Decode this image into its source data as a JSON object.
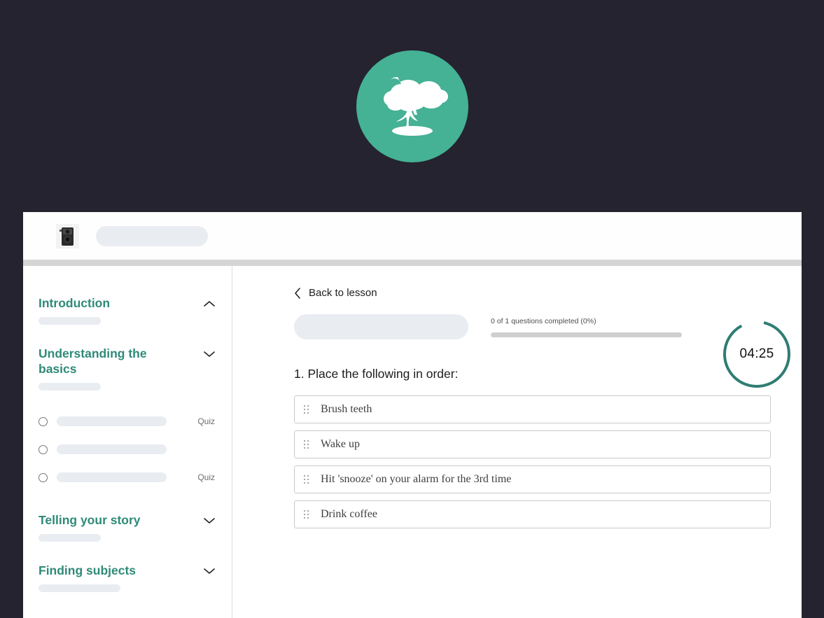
{
  "theme": {
    "page_background": "#25232f",
    "brand_teal": "#45b195",
    "heading_teal": "#2f8a78",
    "skeleton": "#e9edf2",
    "timer_ring": "#2f7d72"
  },
  "brand": {
    "logo_icon": "bonsai-tree-icon",
    "logo_alt": "Bonsai tree logo"
  },
  "topbar": {
    "site_logo_icon": "twin-lens-camera-icon"
  },
  "sidebar": {
    "sections": [
      {
        "title": "Introduction",
        "chevron": "chevron-up-icon",
        "expanded": true,
        "skeleton_width": 89
      },
      {
        "title": "Understanding the basics",
        "chevron": "chevron-down-icon",
        "expanded": false,
        "skeleton_width": 89
      },
      {
        "title": "Telling your story",
        "chevron": "chevron-down-icon",
        "expanded": false,
        "skeleton_width": 89
      },
      {
        "title": "Finding subjects",
        "chevron": "chevron-down-icon",
        "expanded": false,
        "skeleton_width": 117
      }
    ],
    "lessons": [
      {
        "status_icon": "radio-unchecked-icon",
        "tag": "Quiz"
      },
      {
        "status_icon": "radio-unchecked-icon",
        "tag": ""
      },
      {
        "status_icon": "radio-unchecked-icon",
        "tag": "Quiz"
      }
    ]
  },
  "main": {
    "back_link": {
      "label": "Back to lesson",
      "icon": "chevron-left-icon"
    },
    "progress": {
      "label": "0 of 1 questions completed (0%)",
      "percent": 0
    },
    "timer": {
      "value": "04:25",
      "icon": "countdown-ring-icon",
      "fraction_remaining": 0.885
    },
    "question": {
      "text": "1. Place the following in order:",
      "options": [
        {
          "label": "Brush teeth",
          "handle_icon": "drag-handle-icon"
        },
        {
          "label": "Wake up",
          "handle_icon": "drag-handle-icon"
        },
        {
          "label": "Hit 'snooze' on your alarm for the 3rd time",
          "handle_icon": "drag-handle-icon"
        },
        {
          "label": "Drink coffee",
          "handle_icon": "drag-handle-icon"
        }
      ]
    }
  }
}
